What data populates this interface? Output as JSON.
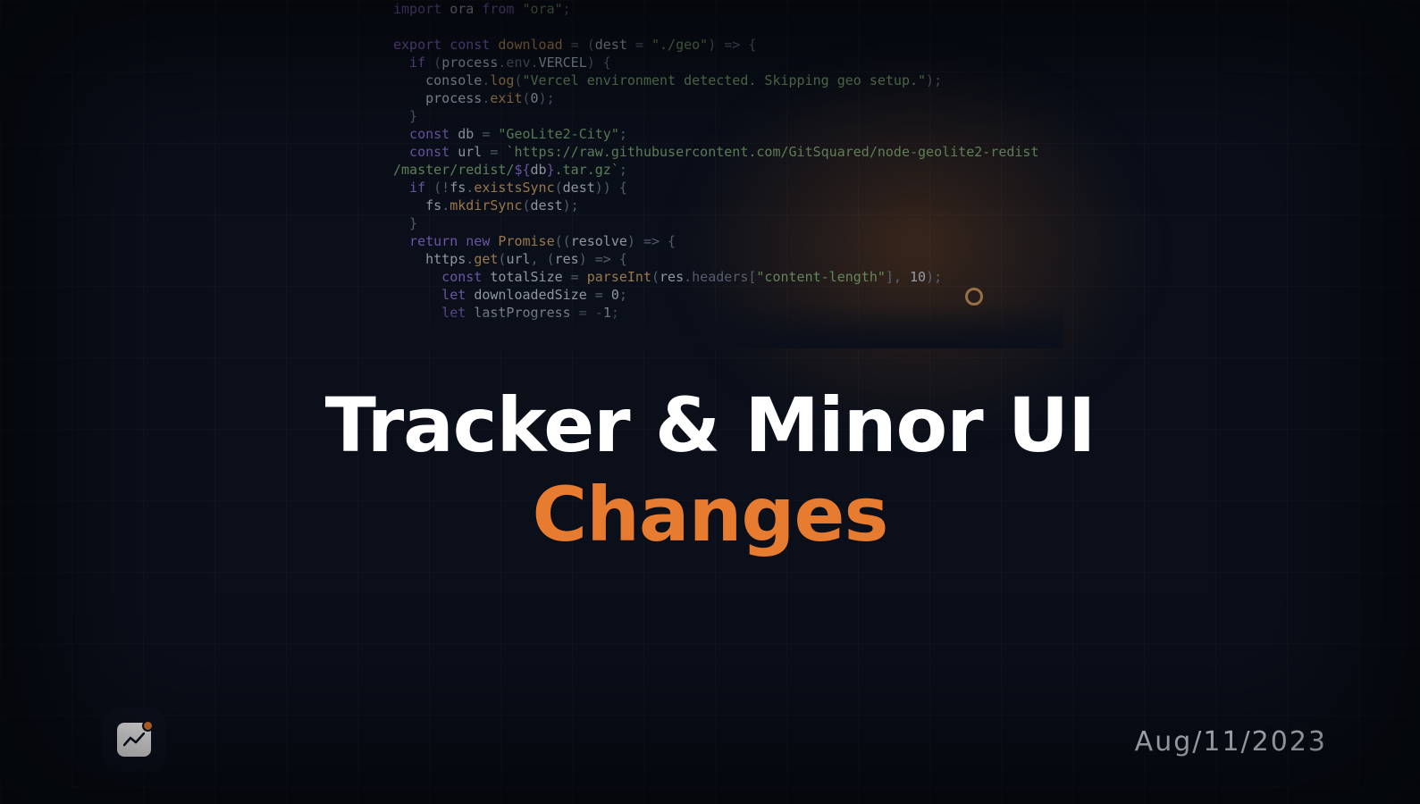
{
  "hero": {
    "title_line_1": "Tracker & Minor UI",
    "title_line_2": "Changes",
    "date": "Aug/11/2023"
  },
  "code": {
    "line1_a": "import ",
    "line1_b": "ora",
    "line1_c": " from ",
    "line1_d": "\"ora\"",
    "line1_e": ";",
    "line2_a": "export const ",
    "line2_b": "download",
    "line2_c": " = (",
    "line2_d": "dest",
    "line2_e": " = ",
    "line2_f": "\"./geo\"",
    "line2_g": ") => {",
    "line3_a": "  if ",
    "line3_b": "(",
    "line3_c": "process",
    "line3_d": ".env.",
    "line3_e": "VERCEL",
    "line3_f": ") {",
    "line4_a": "    console",
    "line4_b": ".",
    "line4_c": "log",
    "line4_d": "(",
    "line4_e": "\"Vercel environment detected. Skipping geo setup.\"",
    "line4_f": ");",
    "line5_a": "    process",
    "line5_b": ".",
    "line5_c": "exit",
    "line5_d": "(",
    "line5_e": "0",
    "line5_f": ");",
    "line6": "  }",
    "line7_a": "  const ",
    "line7_b": "db",
    "line7_c": " = ",
    "line7_d": "\"GeoLite2-City\"",
    "line7_e": ";",
    "line8_a": "  const ",
    "line8_b": "url",
    "line8_c": " = ",
    "line8_d": "`https://raw.githubusercontent.com/GitSquared/node-geolite2-redist",
    "line9_a": "/master/redist/",
    "line9_b": "${",
    "line9_c": "db",
    "line9_d": "}",
    "line9_e": ".tar.gz`",
    "line9_f": ";",
    "line10_a": "  if ",
    "line10_b": "(!",
    "line10_c": "fs",
    "line10_d": ".",
    "line10_e": "existsSync",
    "line10_f": "(",
    "line10_g": "dest",
    "line10_h": ")) {",
    "line11_a": "    fs",
    "line11_b": ".",
    "line11_c": "mkdirSync",
    "line11_d": "(",
    "line11_e": "dest",
    "line11_f": ");",
    "line12": "  }",
    "line13_a": "  return new ",
    "line13_b": "Promise",
    "line13_c": "((",
    "line13_d": "resolve",
    "line13_e": ") => {",
    "line14_a": "    https",
    "line14_b": ".",
    "line14_c": "get",
    "line14_d": "(",
    "line14_e": "url",
    "line14_f": ", (",
    "line14_g": "res",
    "line14_h": ") => {",
    "line15_a": "      const ",
    "line15_b": "totalSize",
    "line15_c": " = ",
    "line15_d": "parseInt",
    "line15_e": "(",
    "line15_f": "res",
    "line15_g": ".headers[",
    "line15_h": "\"content-length\"",
    "line15_i": "], ",
    "line15_j": "10",
    "line15_k": ");",
    "line16_a": "      let ",
    "line16_b": "downloadedSize",
    "line16_c": " = ",
    "line16_d": "0",
    "line16_e": ";",
    "line17_a": "      let ",
    "line17_b": "lastProgress",
    "line17_c": " = -",
    "line17_d": "1",
    "line17_e": ";"
  }
}
